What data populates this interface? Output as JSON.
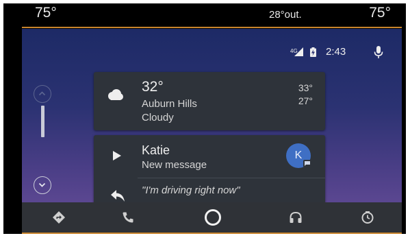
{
  "climate": {
    "left_temp": "75°",
    "outside_temp": "28°out.",
    "right_temp": "75°"
  },
  "status": {
    "network": "4G",
    "time": "2:43",
    "mic_icon": "mic-icon"
  },
  "scroll": {
    "up_icon": "chevron-up-icon",
    "down_icon": "chevron-down-icon"
  },
  "weather": {
    "icon": "cloud-icon",
    "temp": "32°",
    "city": "Auburn Hills",
    "condition": "Cloudy",
    "high": "33°",
    "low": "27°"
  },
  "message": {
    "play_icon": "play-icon",
    "name": "Katie",
    "subtitle": "New message",
    "avatar_letter": "K",
    "reply_icon": "reply-icon",
    "reply_text": "\"I'm driving right now\""
  },
  "navbar": {
    "items": [
      {
        "icon": "navigation-icon"
      },
      {
        "icon": "phone-icon"
      },
      {
        "icon": "home-circle-icon"
      },
      {
        "icon": "headphones-icon"
      },
      {
        "icon": "recents-icon"
      }
    ]
  },
  "colors": {
    "accent": "#c8842c",
    "card_bg": "#2e333a",
    "avatar": "#3f6fc4"
  }
}
